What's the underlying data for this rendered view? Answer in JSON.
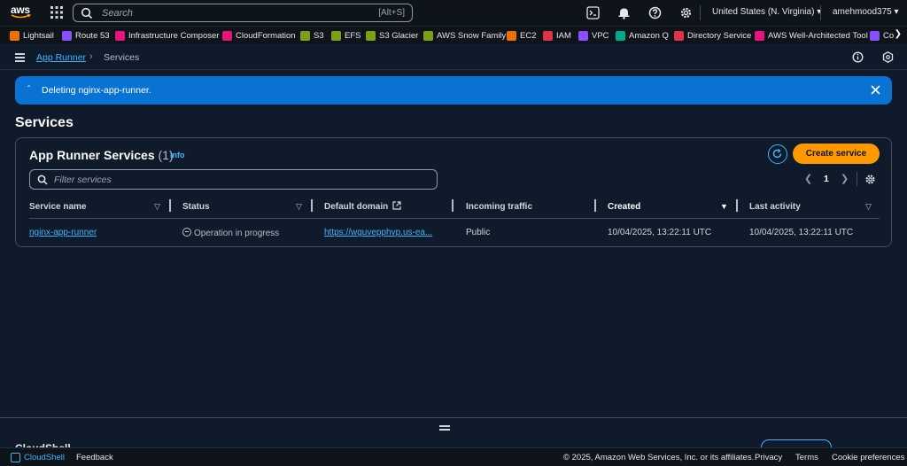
{
  "topnav": {
    "logo_text": "aws",
    "search_placeholder": "Search",
    "search_shortcut": "[Alt+S]",
    "region": "United States (N. Virginia) ▾",
    "user": "amehmood375 ▾",
    "icons": [
      "cloudshell-icon",
      "bell-icon",
      "help-icon",
      "gear-icon"
    ]
  },
  "favorites": [
    {
      "label": "Lightsail",
      "color": "#ed7100"
    },
    {
      "label": "Route 53",
      "color": "#8c4fff"
    },
    {
      "label": "Infrastructure Composer",
      "color": "#e7157b"
    },
    {
      "label": "CloudFormation",
      "color": "#e7157b"
    },
    {
      "label": "S3",
      "color": "#7aa116"
    },
    {
      "label": "EFS",
      "color": "#7aa116"
    },
    {
      "label": "S3 Glacier",
      "color": "#7aa116"
    },
    {
      "label": "AWS Snow Family",
      "color": "#7aa116"
    },
    {
      "label": "EC2",
      "color": "#ed7100"
    },
    {
      "label": "IAM",
      "color": "#dd344c"
    },
    {
      "label": "VPC",
      "color": "#8c4fff"
    },
    {
      "label": "Amazon Q",
      "color": "#01a88d"
    },
    {
      "label": "Directory Service",
      "color": "#dd344c"
    },
    {
      "label": "AWS Well-Architected Tool",
      "color": "#e7157b"
    },
    {
      "label": "Co",
      "color": "#8c4fff"
    }
  ],
  "breadcrumb": {
    "root": "App Runner",
    "current": "Services"
  },
  "flash": {
    "message": "Deleting nginx-app-runner."
  },
  "page": {
    "title": "Services"
  },
  "services_panel": {
    "title": "App Runner Services",
    "count": "(1)",
    "info": "Info",
    "create_label": "Create service",
    "filter_placeholder": "Filter services",
    "page_number": "1",
    "columns": [
      "Service name",
      "Status",
      "Default domain",
      "Incoming traffic",
      "Created",
      "Last activity"
    ],
    "rows": [
      {
        "service_name": "nginx-app-runner",
        "status": "Operation in progress",
        "default_domain": "https://wguvepphvp.us-ea...",
        "incoming_traffic": "Public",
        "created": "10/04/2025, 13:22:11 UTC",
        "last_activity": "10/04/2025, 13:22:11 UTC"
      }
    ]
  },
  "cloudshell": {
    "title": "CloudShell"
  },
  "footer": {
    "cloudshell": "CloudShell",
    "feedback": "Feedback",
    "copyright": "© 2025, Amazon Web Services, Inc. or its affiliates.",
    "privacy": "Privacy",
    "terms": "Terms",
    "cookies": "Cookie preferences"
  }
}
